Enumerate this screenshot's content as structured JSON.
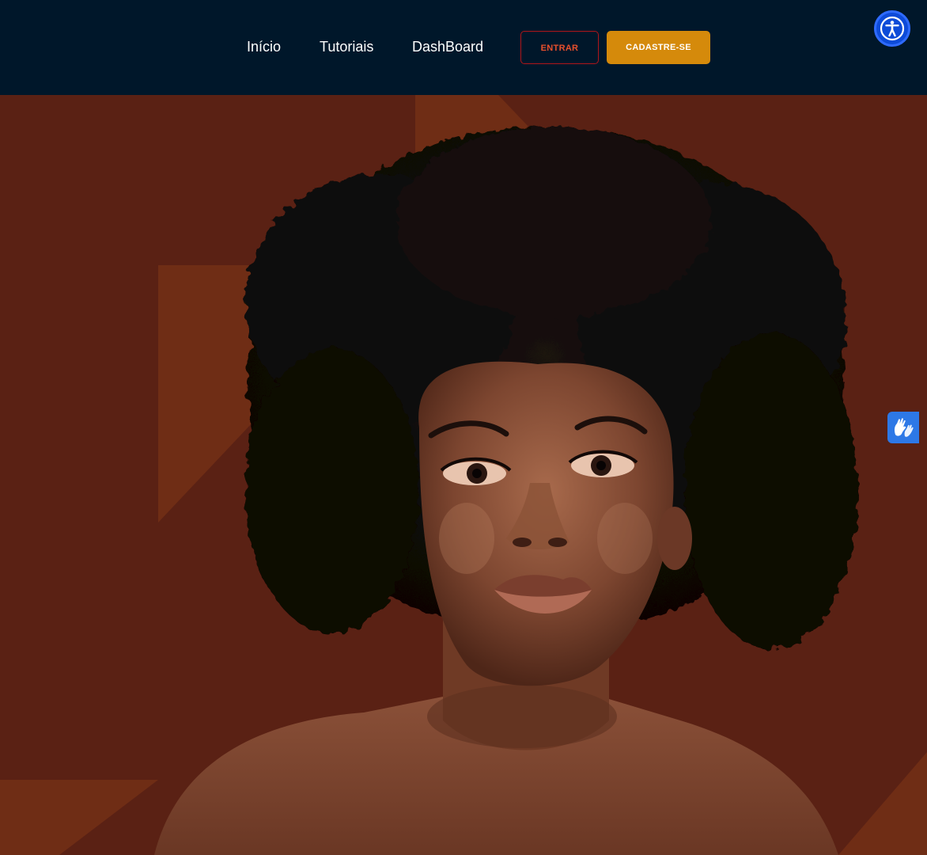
{
  "header": {
    "nav": [
      {
        "label": "Início"
      },
      {
        "label": "Tutoriais"
      },
      {
        "label": "DashBoard"
      }
    ],
    "login_label": "ENTRAR",
    "signup_label": "CADASTRE-SE"
  },
  "widgets": {
    "accessibility_icon": "accessibility-icon",
    "sign_language_icon": "sign-language-hands-icon"
  },
  "hero": {
    "image": "portrait-woman-afro-hair",
    "background_color": "#5a2114",
    "accent_color": "#6f2d15"
  },
  "colors": {
    "header_bg": "#00172a",
    "login_border": "#b0161a",
    "login_text": "#e8502c",
    "signup_bg": "#d58a0b",
    "accessibility_blue": "#0d4bd8",
    "libras_blue": "#2d78e6"
  }
}
